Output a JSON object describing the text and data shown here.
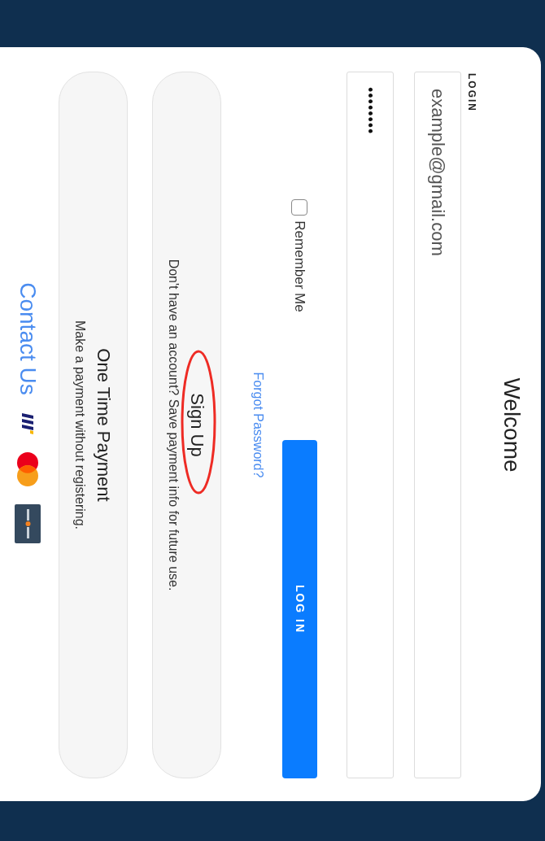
{
  "title": "Welcome",
  "login": {
    "label": "LOGIN",
    "email": {
      "value": "example@gmail.com"
    },
    "password": {
      "value": "••••••••"
    },
    "remember": {
      "label": "Remember Me",
      "checked": false
    },
    "button": "LOG IN",
    "forgot": "Forgot Password?"
  },
  "options": [
    {
      "title": "Sign Up",
      "subtitle": "Don't have an account? Save payment info for future use.",
      "circled": true
    },
    {
      "title": "One Time Payment",
      "subtitle": "Make a payment without registering.",
      "circled": false
    }
  ],
  "footer": {
    "contact": "Contact Us"
  }
}
